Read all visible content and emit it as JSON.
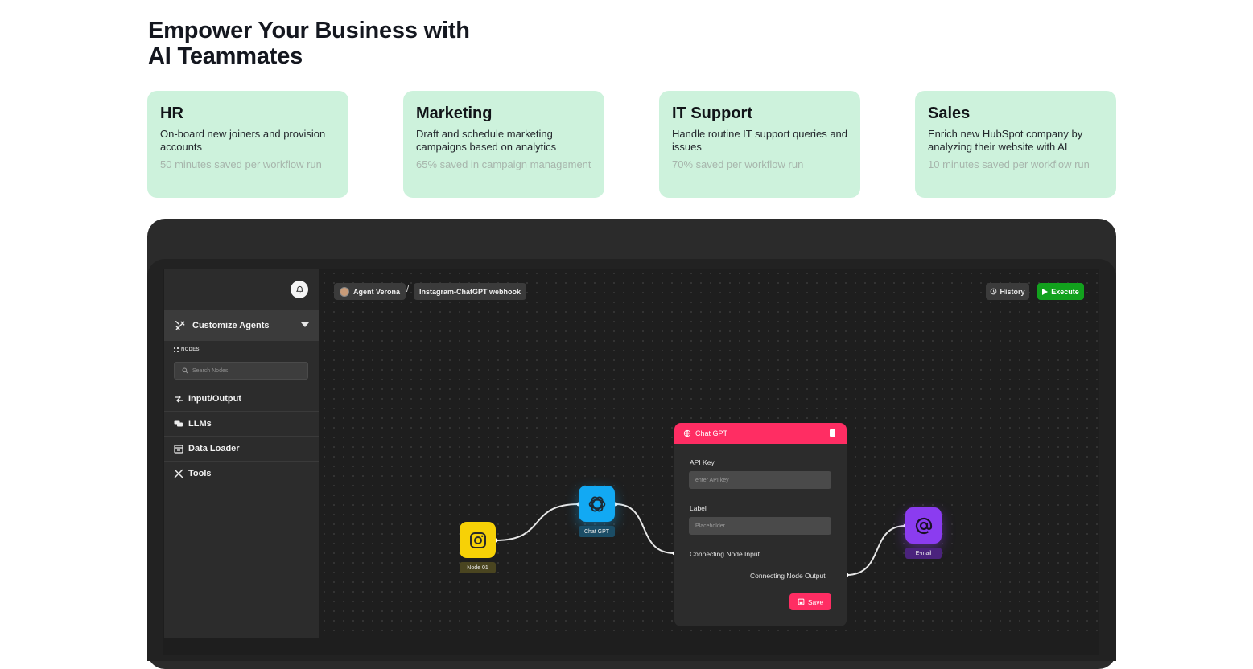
{
  "hero": {
    "line1": "Empower Your Business with",
    "line2": "AI Teammates"
  },
  "cards": [
    {
      "title": "HR",
      "desc": "On-board new joiners and provision accounts",
      "saved": "50 minutes saved per workflow run"
    },
    {
      "title": "Marketing",
      "desc": "Draft and schedule marketing campaigns based on analytics",
      "saved": "65% saved in campaign management"
    },
    {
      "title": "IT Support",
      "desc": "Handle routine IT support queries and issues",
      "saved": "70% saved per workflow run"
    },
    {
      "title": "Sales",
      "desc": "Enrich new HubSpot company by analyzing their website with AI",
      "saved": "10 minutes saved per workflow run"
    }
  ],
  "app": {
    "sidebar": {
      "customize_label": "Customize Agents",
      "nodes_label": "NODES",
      "search_placeholder": "Search Nodes",
      "items": [
        {
          "label": "Input/Output",
          "icon": "input-output-icon"
        },
        {
          "label": "LLMs",
          "icon": "chat-icon"
        },
        {
          "label": "Data Loader",
          "icon": "data-loader-icon"
        },
        {
          "label": "Tools",
          "icon": "tools-icon"
        }
      ]
    },
    "breadcrumb": {
      "agent": "Agent Verona",
      "separator": "/",
      "workflow": "Instagram-ChatGPT webhook"
    },
    "toolbar": {
      "history_label": "History",
      "execute_label": "Execute"
    },
    "nodes": {
      "instagram_label": "Node 01",
      "chatgpt_label": "Chat GPT",
      "email_label": "E-mail"
    },
    "panel": {
      "title": "Chat GPT",
      "api_key_label": "API Key",
      "api_key_placeholder": "enter API key",
      "label_label": "Label",
      "label_placeholder": "Placeholder",
      "input_label": "Connecting Node Input",
      "output_label": "Connecting Node Output",
      "save_label": "Save"
    },
    "colors": {
      "accent": "#ff2d63",
      "execute": "#12a11d",
      "instagram": "#f7d106",
      "chatgpt": "#12a9f3",
      "email": "#8b3cf0",
      "card_bg": "#cdf2dc"
    }
  }
}
